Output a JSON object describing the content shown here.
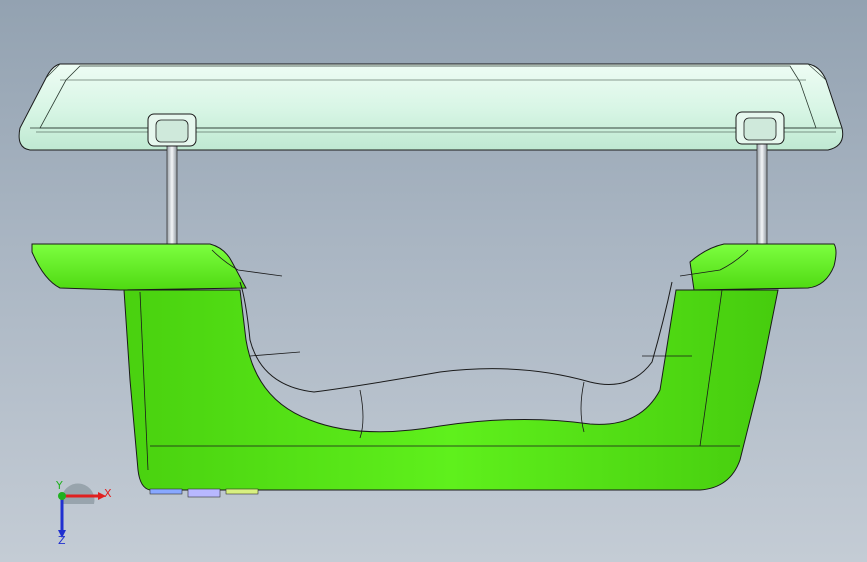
{
  "view": {
    "background_top": "#93a2b1",
    "background_bottom": "#c4ccd5"
  },
  "model": {
    "parts": [
      {
        "name": "mold-cover-plate",
        "color": "#d8f5e6"
      },
      {
        "name": "handle-body",
        "color": "#55e316"
      },
      {
        "name": "guide-pin-left",
        "color": "#c8cfd6"
      },
      {
        "name": "guide-pin-right",
        "color": "#c8cfd6"
      }
    ],
    "edge_color": "#1a1a1a"
  },
  "triad": {
    "x_label": "X",
    "y_label": "Y",
    "z_label": "Z",
    "x_color": "#e02020",
    "y_color": "#20b020",
    "z_color": "#2030d0"
  }
}
